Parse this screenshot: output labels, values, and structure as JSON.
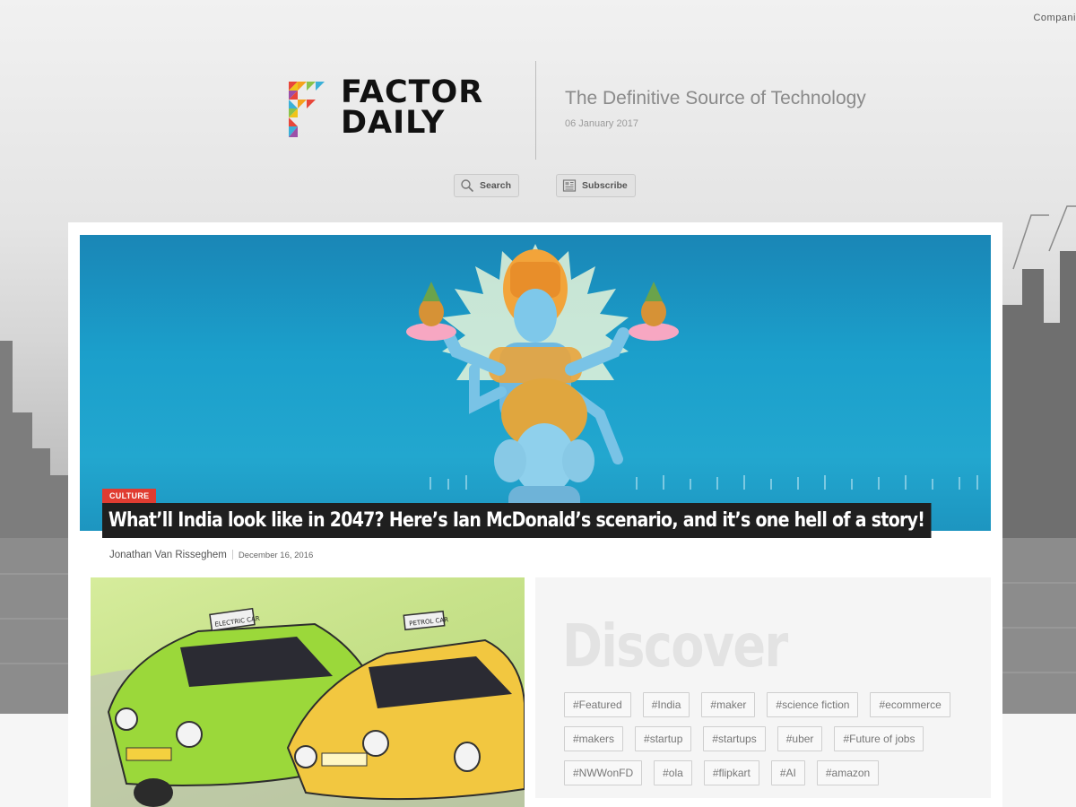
{
  "top_link": "Compani",
  "brand": {
    "name_line1": "FACTOR",
    "name_line2": "DAILY",
    "tagline": "The Definitive Source of Technology",
    "date": "06 January 2017"
  },
  "header_buttons": {
    "search_label": "Search",
    "subscribe_label": "Subscribe"
  },
  "featured": {
    "category": "CULTURE",
    "headline": "What’ll India look like in 2047? Here’s Ian McDonald’s scenario, and it’s one hell of a story!",
    "author": "Jonathan Van Risseghem",
    "date": "December 16, 2016"
  },
  "thumbnail": {
    "sign_left": "ELECTRIC CAR",
    "sign_right": "PETROL CAR"
  },
  "discover": {
    "title": "Discover",
    "tag_rows": [
      [
        "#Featured",
        "#India",
        "#maker",
        "#science fiction",
        "#ecommerce"
      ],
      [
        "#makers",
        "#startup",
        "#startups",
        "#uber",
        "#Future of jobs"
      ],
      [
        "#NWWonFD",
        "#ola",
        "#flipkart",
        "#AI",
        "#amazon"
      ]
    ]
  },
  "colors": {
    "badge": "#e03c31",
    "hero_sky": "#1b9fcb",
    "headline_bg": "#1f1f1f"
  }
}
